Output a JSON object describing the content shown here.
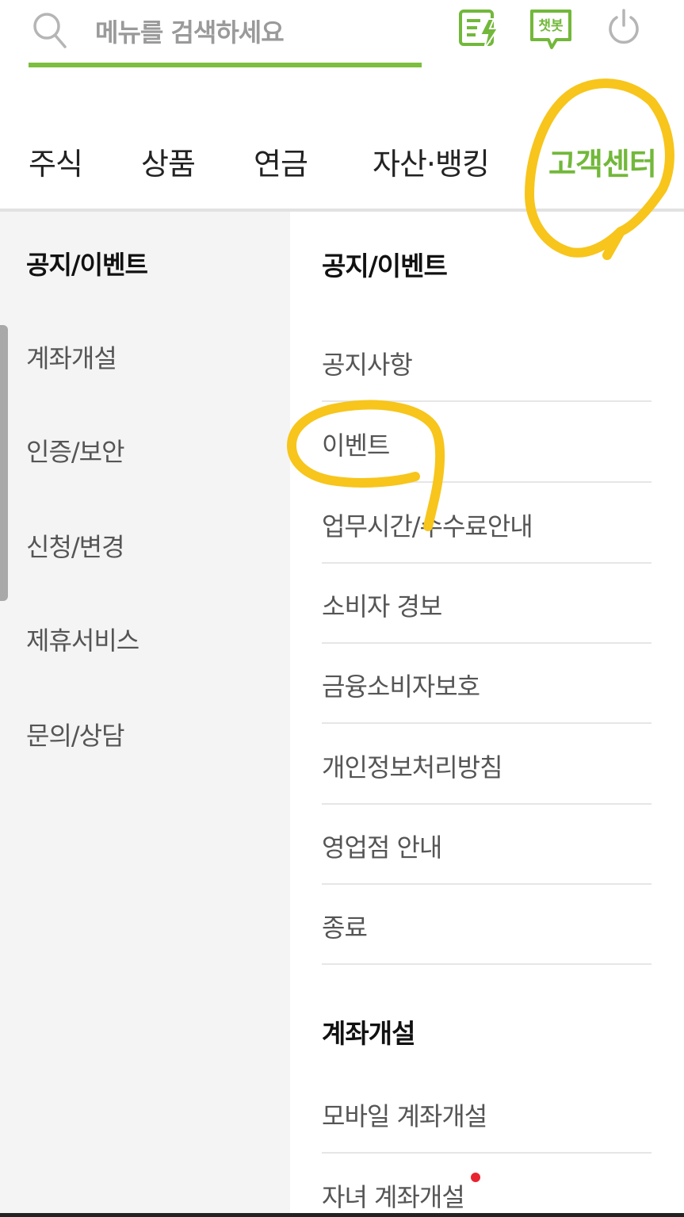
{
  "search": {
    "placeholder": "메뉴를 검색하세요",
    "icon": "search-icon"
  },
  "header_icons": [
    {
      "name": "quick-order-icon"
    },
    {
      "name": "chatbot-icon",
      "label": "챗봇"
    },
    {
      "name": "power-icon"
    }
  ],
  "tabs": [
    {
      "label": "주식",
      "active": false
    },
    {
      "label": "상품",
      "active": false
    },
    {
      "label": "연금",
      "active": false
    },
    {
      "label": "자산·뱅킹",
      "active": false
    },
    {
      "label": "고객센터",
      "active": true
    }
  ],
  "sidebar": {
    "items": [
      {
        "label": "공지/이벤트",
        "selected": true
      },
      {
        "label": "계좌개설",
        "selected": false
      },
      {
        "label": "인증/보안",
        "selected": false
      },
      {
        "label": "신청/변경",
        "selected": false
      },
      {
        "label": "제휴서비스",
        "selected": false
      },
      {
        "label": "문의/상담",
        "selected": false
      }
    ]
  },
  "content": {
    "sections": [
      {
        "title": "공지/이벤트",
        "items": [
          {
            "label": "공지사항"
          },
          {
            "label": "이벤트"
          },
          {
            "label": "업무시간/수수료안내"
          },
          {
            "label": "소비자 경보"
          },
          {
            "label": "금융소비자보호"
          },
          {
            "label": "개인정보처리방침"
          },
          {
            "label": "영업점 안내"
          },
          {
            "label": "종료"
          }
        ]
      },
      {
        "title": "계좌개설",
        "items": [
          {
            "label": "모바일 계좌개설"
          },
          {
            "label": "자녀 계좌개설",
            "new": true
          }
        ]
      }
    ]
  },
  "colors": {
    "accent": "#72b83a",
    "annotation": "#f7c51b",
    "new_dot": "#e8242f"
  }
}
